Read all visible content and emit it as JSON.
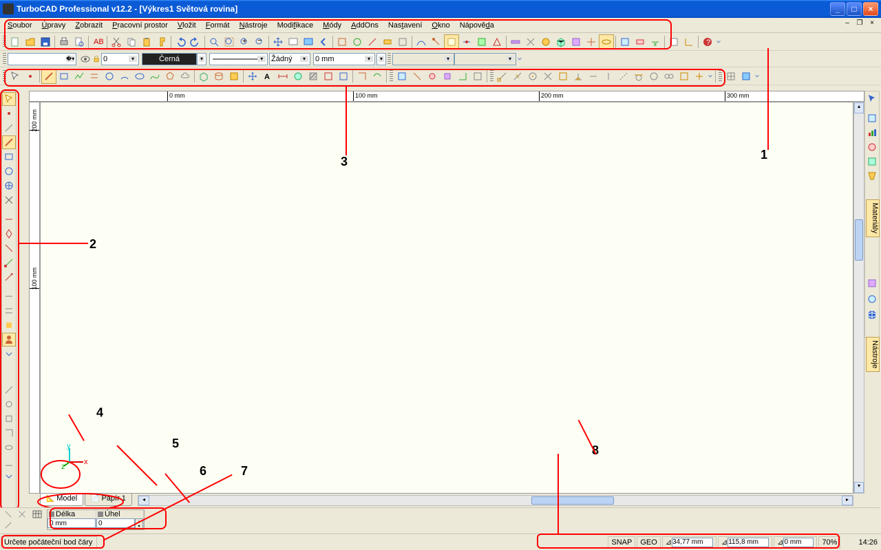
{
  "window": {
    "title": "TurboCAD Professional v12.2 - [Výkres1 Světová rovina]"
  },
  "menu": {
    "items": [
      "Soubor",
      "Úpravy",
      "Zobrazit",
      "Pracovní prostor",
      "Vložit",
      "Formát",
      "Nástroje",
      "Modifikace",
      "Módy",
      "AddOns",
      "Nastavení",
      "Okno",
      "Nápověda"
    ]
  },
  "properties": {
    "layer_value": "0",
    "color_label": "Černá",
    "linetype_label": "Žádný",
    "lineweight_label": "0 mm"
  },
  "ruler": {
    "ticks": [
      "0 mm",
      "100 mm",
      "200 mm",
      "300 mm"
    ]
  },
  "tabs": {
    "model": "Model",
    "paper": "Papír 1"
  },
  "inspector": {
    "length_label": "Délka",
    "length_value": "0 mm",
    "angle_label": "Úhel",
    "angle_value": "0"
  },
  "right_panels": {
    "materials": "Materiály",
    "tools": "Nástroje"
  },
  "status": {
    "prompt": "Určete počáteční bod čáry",
    "snap": "SNAP",
    "geo": "GEO",
    "x_value": "34,77 mm",
    "y_value": "115,8 mm",
    "z_value": "0 mm",
    "zoom": "70%",
    "time": "14:26"
  },
  "callouts": {
    "n1": "1",
    "n2": "2",
    "n3": "3",
    "n4": "4",
    "n5": "5",
    "n6": "6",
    "n7": "7",
    "n8": "8"
  },
  "axis": {
    "x": "x",
    "y": "y",
    "z": "z"
  }
}
